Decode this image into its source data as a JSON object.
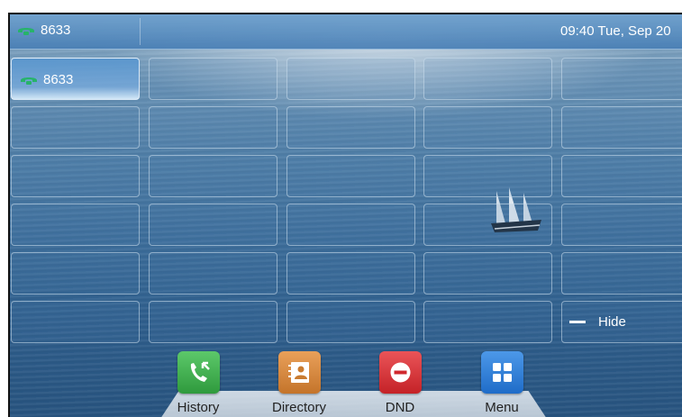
{
  "status_bar": {
    "account": "8633",
    "datetime": "09:40 Tue, Sep 20"
  },
  "line_keys": {
    "key1": "8633",
    "hide": "Hide"
  },
  "softkeys": [
    {
      "label": "History",
      "icon": "history-icon",
      "color": "#3fae49"
    },
    {
      "label": "Directory",
      "icon": "directory-icon",
      "color": "#d98a3d"
    },
    {
      "label": "DND",
      "icon": "dnd-icon",
      "color": "#d9353a"
    },
    {
      "label": "Menu",
      "icon": "menu-icon",
      "color": "#2f7fd6"
    }
  ],
  "colors": {
    "phone_icon": "#27b36a"
  }
}
